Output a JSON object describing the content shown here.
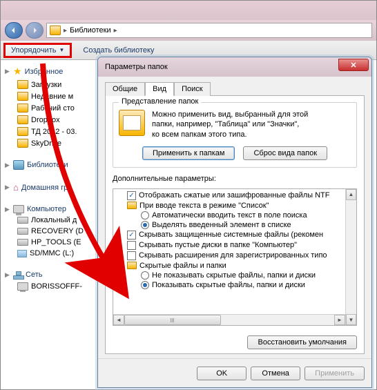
{
  "explorer": {
    "breadcrumb": "Библиотеки",
    "organize": "Упорядочить",
    "create_lib": "Создать библиотеку",
    "nav": {
      "favorites": {
        "label": "Избранное",
        "items": [
          "Загрузки",
          "Недавние м",
          "Рабочий сто",
          "Dropbox",
          "ТД 2012 - 03.",
          "SkyDrive"
        ]
      },
      "libraries": {
        "label": "Библиотеки"
      },
      "homegroup": {
        "label": "Домашняя гру"
      },
      "computer": {
        "label": "Компьютер",
        "items": [
          "Локальный д",
          "RECOVERY (D",
          "HP_TOOLS (E",
          "SD/MMC (L:)"
        ]
      },
      "network": {
        "label": "Сеть",
        "items": [
          "BORISSOFFF-"
        ]
      }
    }
  },
  "dialog": {
    "title": "Параметры папок",
    "tabs": {
      "general": "Общие",
      "view": "Вид",
      "search": "Поиск"
    },
    "folderviews": {
      "legend": "Представление папок",
      "text1": "Можно применить вид, выбранный для этой",
      "text2": "папки, например, \"Таблица\" или \"Значки\",",
      "text3": "ко всем папкам этого типа.",
      "apply_btn": "Применить к папкам",
      "reset_btn": "Сброс вида папок"
    },
    "advanced_label": "Дополнительные параметры:",
    "tree": {
      "i0": {
        "label": "Отображать сжатые или зашифрованные файлы NTF",
        "checked": true
      },
      "i1": {
        "label": "При вводе текста в режиме \"Список\""
      },
      "i1a": {
        "label": "Автоматически вводить текст в поле поиска",
        "checked": false
      },
      "i1b": {
        "label": "Выделять введенный элемент в списке",
        "checked": true
      },
      "i2": {
        "label": "Скрывать защищенные системные файлы (рекомен",
        "checked": true
      },
      "i3": {
        "label": "Скрывать пустые диски в папке \"Компьютер\"",
        "checked": false
      },
      "i4": {
        "label": "Скрывать расширения для зарегистрированных типо",
        "checked": false
      },
      "i5": {
        "label": "Скрытые файлы и папки"
      },
      "i5a": {
        "label": "Не показывать скрытые файлы, папки и диски",
        "checked": false
      },
      "i5b": {
        "label": "Показывать скрытые файлы, папки и диски",
        "checked": true
      }
    },
    "restore": "Восстановить умолчания",
    "ok": "OK",
    "cancel": "Отмена",
    "apply": "Применить"
  }
}
